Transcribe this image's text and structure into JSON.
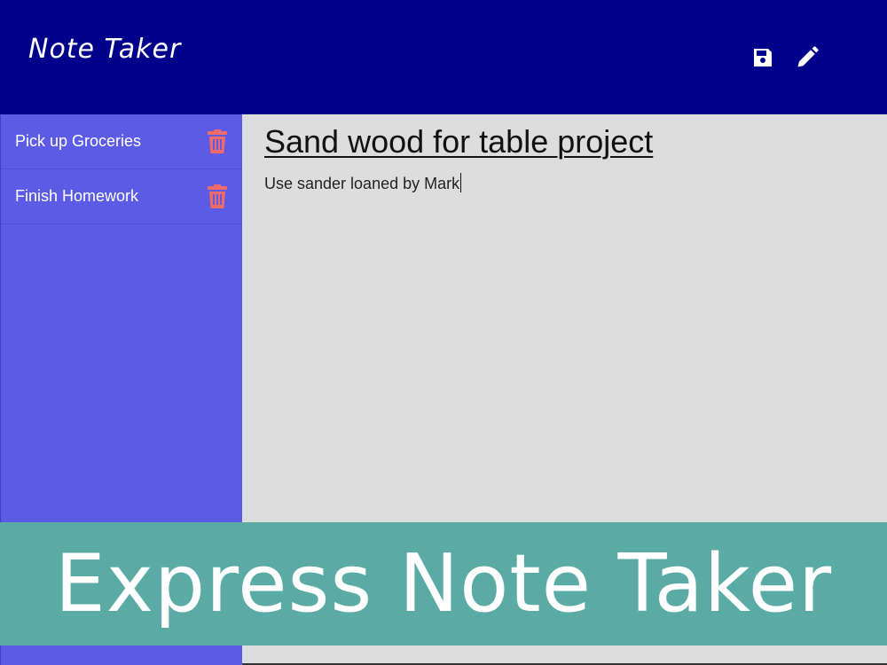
{
  "navbar": {
    "brand": "Note Taker",
    "icons": [
      "floppy-disk-icon",
      "pencil-icon"
    ],
    "bg_color": "#00008b"
  },
  "sidebar": {
    "items": [
      {
        "label": "Pick up Groceries",
        "icon": "trash-icon"
      },
      {
        "label": "Finish Homework",
        "icon": "trash-icon"
      }
    ],
    "bg_color": "#5b5be5",
    "trash_color": "#f06a6a"
  },
  "editor": {
    "title": "Sand wood for table project",
    "text": "Use sander loaned by Mark"
  },
  "banner": {
    "text": "Express Note Taker",
    "bg_color": "#5aaba5"
  }
}
